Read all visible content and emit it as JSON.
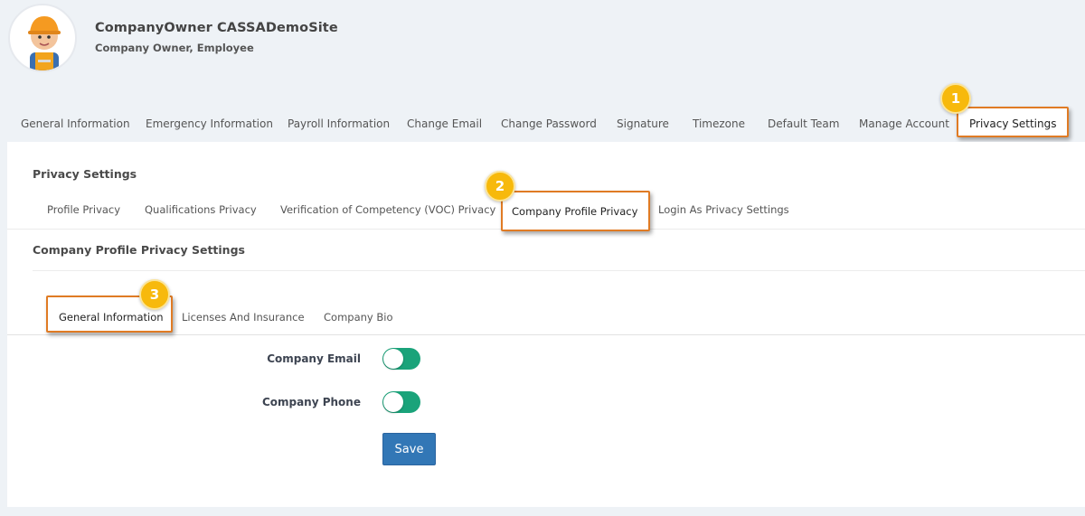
{
  "user": {
    "name": "CompanyOwner CASSADemoSite",
    "roles": "Company Owner, Employee"
  },
  "main_tabs": [
    {
      "label": "General Information"
    },
    {
      "label": "Emergency Information"
    },
    {
      "label": "Payroll Information"
    },
    {
      "label": "Change Email"
    },
    {
      "label": "Change Password"
    },
    {
      "label": "Signature"
    },
    {
      "label": "Timezone"
    },
    {
      "label": "Default Team"
    },
    {
      "label": "Manage Account"
    },
    {
      "label": "Privacy Settings",
      "active": true
    }
  ],
  "privacy": {
    "title": "Privacy Settings",
    "tabs": [
      {
        "label": "Profile Privacy"
      },
      {
        "label": "Qualifications Privacy"
      },
      {
        "label": "Verification of Competency (VOC) Privacy"
      },
      {
        "label": "Company Profile Privacy",
        "active": true
      },
      {
        "label": "Login As Privacy Settings"
      }
    ]
  },
  "company_profile": {
    "title": "Company Profile Privacy Settings",
    "tabs": [
      {
        "label": "General Information",
        "active": true
      },
      {
        "label": "Licenses And Insurance"
      },
      {
        "label": "Company Bio"
      }
    ],
    "fields": [
      {
        "label": "Company Email",
        "enabled": true
      },
      {
        "label": "Company Phone",
        "enabled": true
      }
    ],
    "save_label": "Save"
  },
  "badges": [
    "1",
    "2",
    "3"
  ],
  "colors": {
    "accent_border": "#e07b24",
    "toggle_on": "#1aa37a",
    "save_button": "#3277b6",
    "badge": "#f7b90c"
  }
}
